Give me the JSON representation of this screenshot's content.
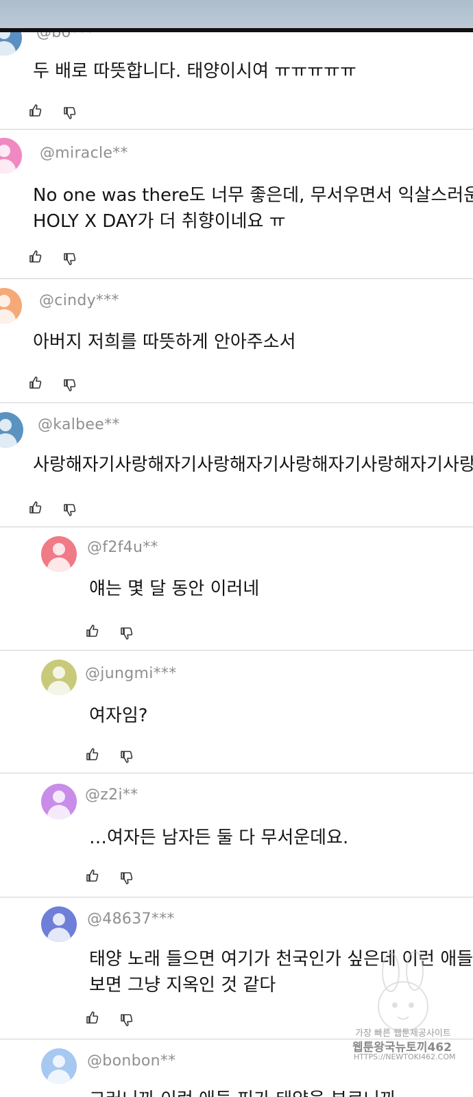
{
  "comments": [
    {
      "username": "@bo***",
      "lines": [
        "두 배로 따뜻합니다. 태양이시여 ㅠㅠㅠㅠㅠ"
      ],
      "avatar_color": "#5b8fc2"
    },
    {
      "username": "@miracle**",
      "lines": [
        "No one was there도 너무 좋은데, 무서우면서 익살스러운",
        "HOLY X DAY가 더 취향이네요 ㅠ"
      ],
      "avatar_color": "#f089c2"
    },
    {
      "username": "@cindy***",
      "lines": [
        "아버지 저희를 따뜻하게 안아주소서"
      ],
      "avatar_color": "#f5a978"
    },
    {
      "username": "@kalbee**",
      "lines": [
        "사랑해자기사랑해자기사랑해자기사랑해자기사랑해자기사랑해"
      ],
      "avatar_color": "#5b93c0"
    },
    {
      "username": "@f2f4u**",
      "lines": [
        "얘는 몇 달 동안 이러네"
      ],
      "avatar_color": "#f07a86"
    },
    {
      "username": "@jungmi***",
      "lines": [
        "여자임?"
      ],
      "avatar_color": "#c9c97a"
    },
    {
      "username": "@z2i**",
      "lines": [
        "…여자든 남자든 둘 다 무서운데요."
      ],
      "avatar_color": "#c98ce8"
    },
    {
      "username": "@48637***",
      "lines": [
        "태양 노래 들으면 여기가 천국인가 싶은데 이런 애들",
        "보면 그냥 지옥인 것 같다"
      ],
      "avatar_color": "#6e7fd8"
    },
    {
      "username": "@bonbon**",
      "lines": [
        "그러니까 이런 애들 피가 태양을 부르니까"
      ],
      "avatar_color": "#a7c8f0"
    }
  ],
  "icons": {
    "like": "thumbs-up-icon",
    "dislike": "thumbs-down-icon"
  },
  "watermark": {
    "line1": "가장 빠른 웹툰제공사이트",
    "line2": "웹툰왕국뉴토끼462",
    "line3": "HTTPS://NEWTOKI462.COM"
  }
}
